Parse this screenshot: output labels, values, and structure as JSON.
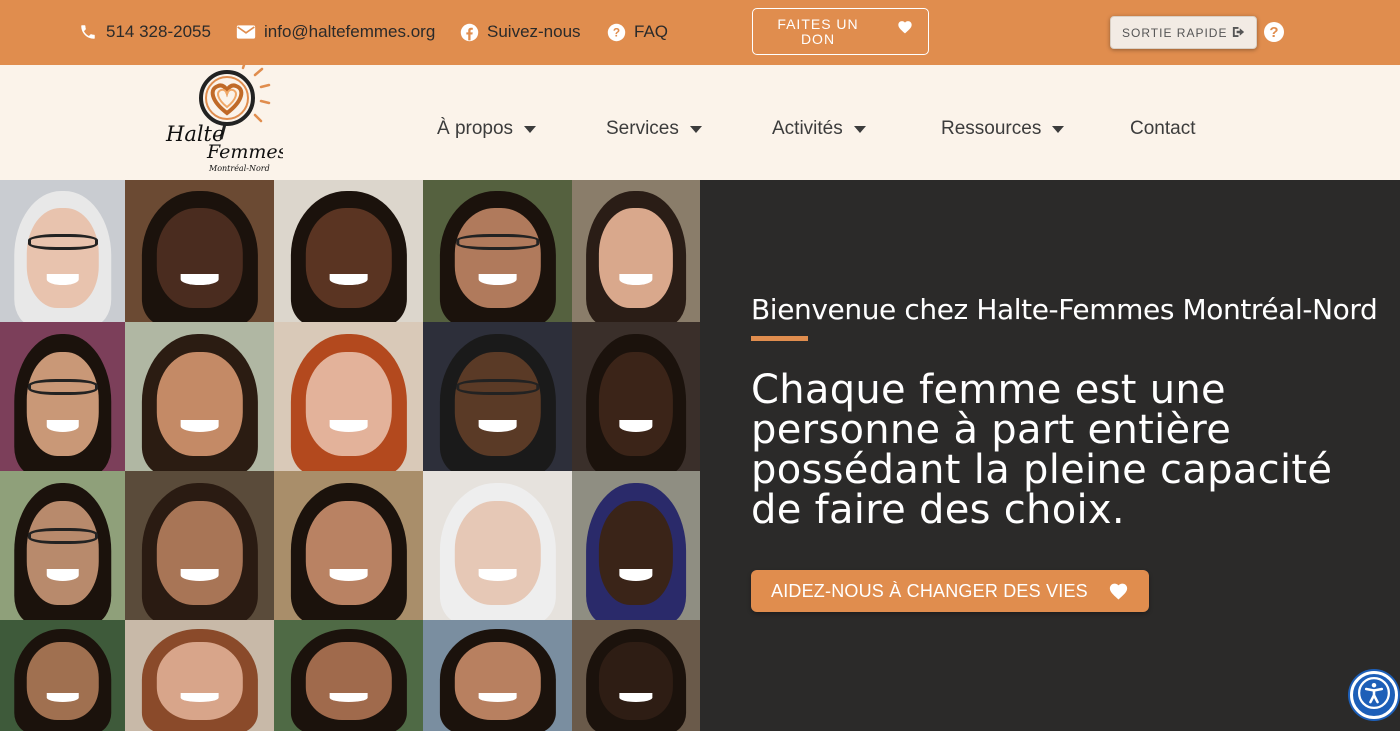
{
  "topbar": {
    "phone": "514 328-2055",
    "email": "info@haltefemmes.org",
    "follow": "Suivez-nous",
    "faq": "FAQ",
    "donate_line1": "FAITES UN",
    "donate_line2": "DON",
    "quick_exit": "SORTIE RAPIDE",
    "help": "?"
  },
  "logo": {
    "line1": "Halte",
    "line2": "Femmes",
    "line3": "Montréal-Nord"
  },
  "nav": {
    "items": [
      {
        "label": "À propos",
        "dropdown": true
      },
      {
        "label": "Services",
        "dropdown": true
      },
      {
        "label": "Activités",
        "dropdown": true
      },
      {
        "label": "Ressources",
        "dropdown": true
      },
      {
        "label": "Contact",
        "dropdown": false
      }
    ]
  },
  "hero": {
    "welcome": "Bienvenue chez Halte-Femmes Montréal-Nord",
    "tagline": "Chaque femme est une personne à part entière possédant la pleine capacité de faire des choix.",
    "cta": "AIDEZ-NOUS À CHANGER DES VIES"
  },
  "colors": {
    "accent": "#e08d4e",
    "dark": "#2b2a29",
    "nav_bg": "#fbf3ea"
  },
  "icons": [
    "phone-icon",
    "envelope-icon",
    "facebook-icon",
    "question-icon",
    "heart-icon",
    "exit-icon",
    "accessibility-icon"
  ]
}
